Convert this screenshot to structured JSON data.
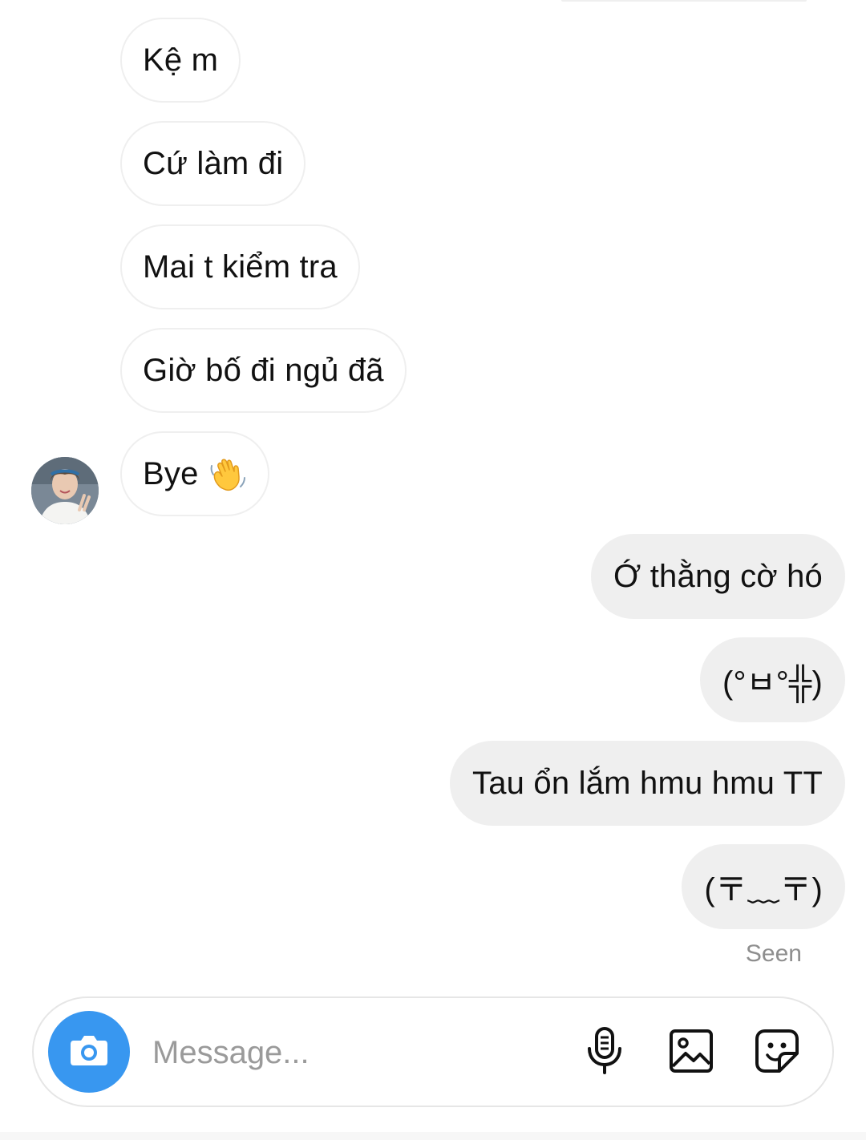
{
  "thread": {
    "incoming": [
      {
        "text": "Kệ m"
      },
      {
        "text": "Cứ làm đi"
      },
      {
        "text": "Mai t kiểm tra"
      },
      {
        "text": "Giờ bố đi ngủ đã"
      },
      {
        "text": "Bye",
        "emoji": "waving-hand"
      }
    ],
    "outgoing": [
      {
        "text": "Ớ thằng cờ hó"
      },
      {
        "text": "(°ㅂ°╬)"
      },
      {
        "text": "Tau ổn lắm hmu hmu TT"
      },
      {
        "text": "(〒﹏〒)"
      }
    ],
    "seen_label": "Seen"
  },
  "composer": {
    "placeholder": "Message...",
    "value": "",
    "icons": [
      "camera-icon",
      "microphone-icon",
      "gallery-icon",
      "sticker-icon"
    ]
  },
  "colors": {
    "outgoing_bubble": "#efefef",
    "incoming_border": "#efefef",
    "camera_button": "#3897f0",
    "placeholder": "#9a9a9a",
    "seen_text": "#8e8e8e"
  }
}
